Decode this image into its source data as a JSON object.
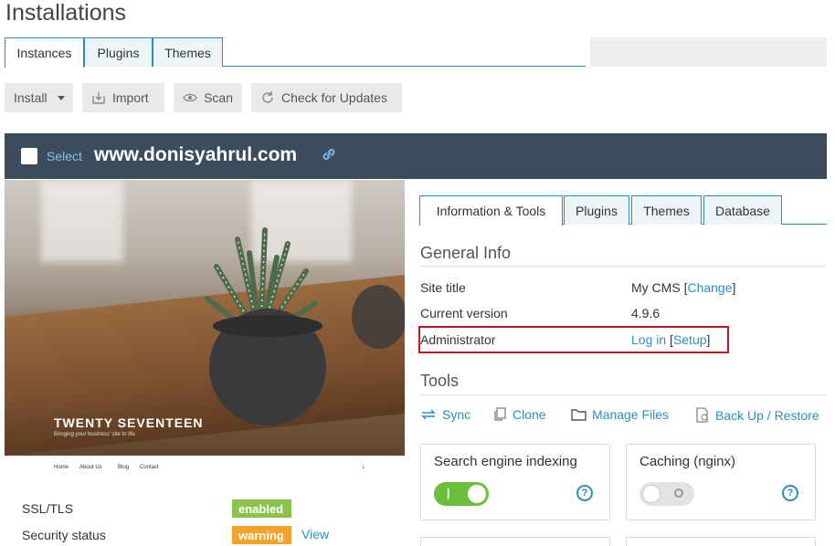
{
  "page": {
    "title": "Installations"
  },
  "top_tabs": [
    {
      "label": "Instances",
      "active": true
    },
    {
      "label": "Plugins",
      "active": false
    },
    {
      "label": "Themes",
      "active": false
    }
  ],
  "toolbar": {
    "install": "Install",
    "import": "Import",
    "scan": "Scan",
    "check_updates": "Check for Updates"
  },
  "site": {
    "select_label": "Select",
    "domain": "www.donisyahrul.com"
  },
  "preview": {
    "theme_title": "TWENTY SEVENTEEN",
    "theme_subtitle": "Bringing your business' site to life",
    "nav": [
      "Home",
      "About Us",
      "Blog",
      "Contact"
    ]
  },
  "status": {
    "ssl_label": "SSL/TLS",
    "ssl_value": "enabled",
    "security_label": "Security status",
    "security_value": "warning",
    "view_label": "View"
  },
  "detail_tabs": [
    {
      "label": "Information & Tools",
      "active": true
    },
    {
      "label": "Plugins",
      "active": false
    },
    {
      "label": "Themes",
      "active": false
    },
    {
      "label": "Database",
      "active": false
    }
  ],
  "general_info": {
    "heading": "General Info",
    "site_title_label": "Site title",
    "site_title_value": "My CMS",
    "change_link": "Change",
    "version_label": "Current version",
    "version_value": "4.9.6",
    "admin_label": "Administrator",
    "login_link": "Log in",
    "setup_link": "Setup"
  },
  "tools": {
    "heading": "Tools",
    "sync": "Sync",
    "clone": "Clone",
    "manage_files": "Manage Files",
    "backup": "Back Up / Restore"
  },
  "cards": {
    "search_indexing": {
      "label": "Search engine indexing",
      "enabled": true
    },
    "caching": {
      "label": "Caching (nginx)",
      "enabled": false
    }
  },
  "colors": {
    "accent": "#2b8fc2",
    "header_bg": "#3b4c5c",
    "highlight": "#c4161c",
    "badge_enabled": "#8bc34a",
    "badge_warning": "#f3a22a",
    "toggle_on": "#6cbf3b"
  }
}
